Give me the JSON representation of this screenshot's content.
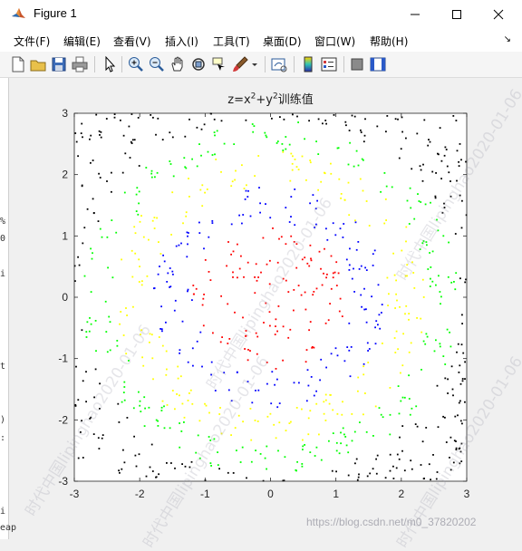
{
  "window": {
    "title": "Figure 1"
  },
  "menu": [
    "文件(F)",
    "编辑(E)",
    "查看(V)",
    "插入(I)",
    "工具(T)",
    "桌面(D)",
    "窗口(W)",
    "帮助(H)"
  ],
  "toolbar": [
    "new-figure-icon",
    "open-file-icon",
    "save-icon",
    "print-icon",
    "pointer-icon",
    "zoom-in-icon",
    "zoom-out-icon",
    "pan-icon",
    "rotate-3d-icon",
    "data-cursor-icon",
    "brush-icon",
    "link-plot-icon",
    "colorbar-icon",
    "legend-icon",
    "hide-plot-tools-icon",
    "show-plot-tools-icon"
  ],
  "plot": {
    "title_main": "z=x",
    "title_sup1": "2",
    "title_plus": "+y",
    "title_sup2": "2",
    "title_tail": "训练值"
  },
  "left_edge_glyphs": [
    "%",
    "0",
    "i",
    "t",
    ")",
    ":",
    "i",
    "eap"
  ],
  "watermark": "时代中国lipinghao2020-01-06",
  "csdn_credit": "https://blog.csdn.net/m0_37820202",
  "chart_data": {
    "type": "scatter",
    "title": "z=x²+y²训练值",
    "xlim": [
      -3,
      3
    ],
    "ylim": [
      -3,
      3
    ],
    "xticks": [
      -3,
      -2,
      -1,
      0,
      1,
      2,
      3
    ],
    "yticks": [
      -3,
      -2,
      -1,
      0,
      1,
      2,
      3
    ],
    "grid": false,
    "legend": "none",
    "sample_count": 1000,
    "color_bands": [
      {
        "color": "#ff0000",
        "r_min": 0.0,
        "r_max": 1.2
      },
      {
        "color": "#0000ff",
        "r_min": 1.2,
        "r_max": 1.8
      },
      {
        "color": "#ffff00",
        "r_min": 1.8,
        "r_max": 2.4
      },
      {
        "color": "#00ff00",
        "r_min": 2.4,
        "r_max": 2.9
      },
      {
        "color": "#000000",
        "r_min": 2.9,
        "r_max": 99
      }
    ]
  }
}
